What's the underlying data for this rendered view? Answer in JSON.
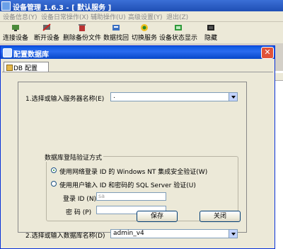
{
  "app": {
    "title": "设备管理 1.6.3  - [ 默认服务 ]",
    "menu": [
      "设备信息(Y)",
      "设备日常操作(X)",
      "辅助操作(U)",
      "高级设置(Y)",
      "退出(Z)"
    ],
    "toolbar": [
      {
        "label": "连接设备",
        "icon": "connect-icon"
      },
      {
        "label": "断开设备",
        "icon": "disconnect-icon"
      },
      {
        "label": "删除备份文件",
        "icon": "delete-backup-icon"
      },
      {
        "label": "数据找回",
        "icon": "data-recovery-icon"
      },
      {
        "label": "切换服务",
        "icon": "switch-service-icon"
      },
      {
        "label": "设备状态显示",
        "icon": "device-status-icon"
      },
      {
        "label": "隐藏",
        "icon": "hide-icon"
      }
    ]
  },
  "dialog": {
    "title": "配置数据库",
    "close_label": "✕",
    "tab": "DB 配置",
    "server_label": "1.选择或输入服务器名称(E)",
    "server_value": ".",
    "auth_group": "数据库登陆验证方式",
    "radio_windows": "使用网络登录 ID 的 Windows NT 集成安全验证(W)",
    "radio_sql": "使用用户输入 ID 和密码的 SQL Server 验证(U)",
    "login_label": "登录 ID (N)",
    "login_value": "sa",
    "password_label": "密  码 (P)",
    "password_value": "",
    "db_label": "2.选择或输入数据库名称(D)",
    "db_value": "admin_v4",
    "save_label": "保存",
    "close_button_label": "关闭",
    "auth_selected": "windows"
  },
  "colors": {
    "title_blue": "#0a58e0",
    "close_red": "#e0533a",
    "dialog_bg": "#ece9d8"
  }
}
